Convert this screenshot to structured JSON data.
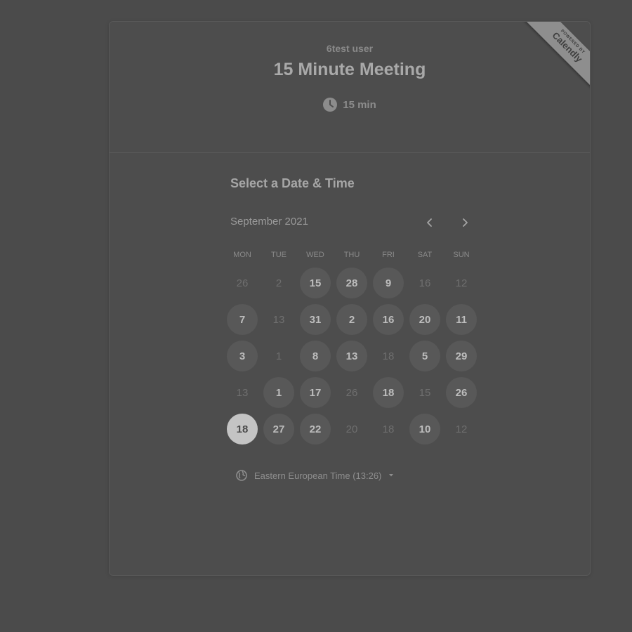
{
  "header": {
    "username": "6test user",
    "event_title": "15 Minute Meeting",
    "duration": "15 min",
    "duration_icon": "clock-icon"
  },
  "ribbon": {
    "powered_by": "POWERED BY",
    "brand": "Calendly"
  },
  "calendar": {
    "section_title": "Select a Date & Time",
    "month_label": "September 2021",
    "prev_icon": "chevron-left-icon",
    "next_icon": "chevron-right-icon",
    "weekdays": [
      "MON",
      "TUE",
      "WED",
      "THU",
      "FRI",
      "SAT",
      "SUN"
    ],
    "days": [
      {
        "label": "26",
        "state": "unavailable"
      },
      {
        "label": "2",
        "state": "unavailable"
      },
      {
        "label": "15",
        "state": "available"
      },
      {
        "label": "28",
        "state": "available"
      },
      {
        "label": "9",
        "state": "available"
      },
      {
        "label": "16",
        "state": "unavailable"
      },
      {
        "label": "12",
        "state": "unavailable"
      },
      {
        "label": "7",
        "state": "available"
      },
      {
        "label": "13",
        "state": "unavailable"
      },
      {
        "label": "31",
        "state": "available"
      },
      {
        "label": "2",
        "state": "available"
      },
      {
        "label": "16",
        "state": "available"
      },
      {
        "label": "20",
        "state": "available"
      },
      {
        "label": "11",
        "state": "available"
      },
      {
        "label": "3",
        "state": "available"
      },
      {
        "label": "1",
        "state": "unavailable"
      },
      {
        "label": "8",
        "state": "available"
      },
      {
        "label": "13",
        "state": "available"
      },
      {
        "label": "18",
        "state": "unavailable"
      },
      {
        "label": "5",
        "state": "available"
      },
      {
        "label": "29",
        "state": "available"
      },
      {
        "label": "13",
        "state": "unavailable"
      },
      {
        "label": "1",
        "state": "available"
      },
      {
        "label": "17",
        "state": "available"
      },
      {
        "label": "26",
        "state": "unavailable"
      },
      {
        "label": "18",
        "state": "available"
      },
      {
        "label": "15",
        "state": "unavailable"
      },
      {
        "label": "26",
        "state": "available"
      },
      {
        "label": "18",
        "state": "selected"
      },
      {
        "label": "27",
        "state": "available"
      },
      {
        "label": "22",
        "state": "available"
      },
      {
        "label": "20",
        "state": "unavailable"
      },
      {
        "label": "18",
        "state": "unavailable"
      },
      {
        "label": "10",
        "state": "available"
      },
      {
        "label": "12",
        "state": "unavailable"
      }
    ]
  },
  "timezone": {
    "label": "Eastern European Time (13:26)",
    "icon": "globe-icon",
    "caret_icon": "caret-down-icon"
  },
  "colors": {
    "page_bg": "#4b4b4b",
    "available_bg": "#585858",
    "selected_bg": "#c4c4c4"
  }
}
